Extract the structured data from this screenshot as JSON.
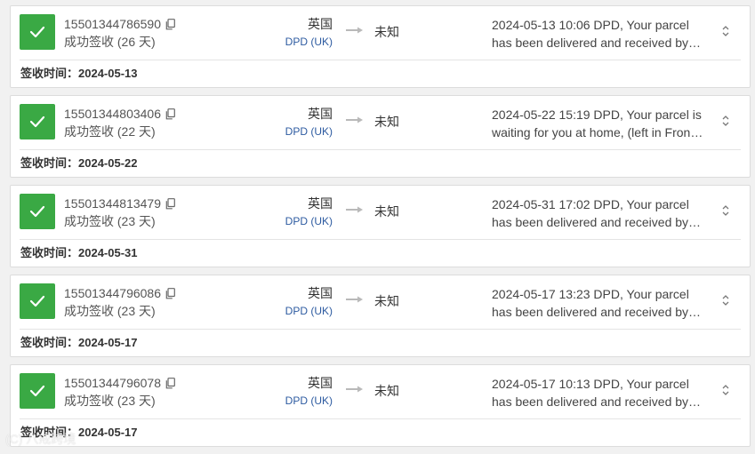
{
  "shipments": [
    {
      "tracking_number": "15501344786590",
      "status": "成功签收 (26 天)",
      "origin_country": "英国",
      "carrier": "DPD (UK)",
      "destination_country": "未知",
      "event_line1": "2024-05-13 10:06  DPD, Your parcel",
      "event_line2": "has been delivered and received by…",
      "signed_label": "签收时间：",
      "signed_date": "2024-05-13"
    },
    {
      "tracking_number": "15501344803406",
      "status": "成功签收 (22 天)",
      "origin_country": "英国",
      "carrier": "DPD (UK)",
      "destination_country": "未知",
      "event_line1": "2024-05-22 15:19  DPD, Your parcel is",
      "event_line2": "waiting for you at home, (left in Fron…",
      "signed_label": "签收时间：",
      "signed_date": "2024-05-22"
    },
    {
      "tracking_number": "15501344813479",
      "status": "成功签收 (23 天)",
      "origin_country": "英国",
      "carrier": "DPD (UK)",
      "destination_country": "未知",
      "event_line1": "2024-05-31 17:02  DPD, Your parcel",
      "event_line2": "has been delivered and received by…",
      "signed_label": "签收时间：",
      "signed_date": "2024-05-31"
    },
    {
      "tracking_number": "15501344796086",
      "status": "成功签收 (23 天)",
      "origin_country": "英国",
      "carrier": "DPD (UK)",
      "destination_country": "未知",
      "event_line1": "2024-05-17 13:23  DPD, Your parcel",
      "event_line2": "has been delivered and received by…",
      "signed_label": "签收时间：",
      "signed_date": "2024-05-17"
    },
    {
      "tracking_number": "15501344796078",
      "status": "成功签收 (23 天)",
      "origin_country": "英国",
      "carrier": "DPD (UK)",
      "destination_country": "未知",
      "event_line1": "2024-05-17 10:13  DPD, Your parcel",
      "event_line2": "has been delivered and received by…",
      "signed_label": "签收时间：",
      "signed_date": "2024-05-17"
    }
  ],
  "watermark": "(C) 八戒跨境",
  "icons": {
    "status": "check-icon",
    "copy": "copy-icon",
    "route": "arrow-right-icon",
    "expand": "chevron-up-down-icon"
  },
  "colors": {
    "success_green": "#3aa944",
    "carrier_link": "#2c5aa0"
  }
}
